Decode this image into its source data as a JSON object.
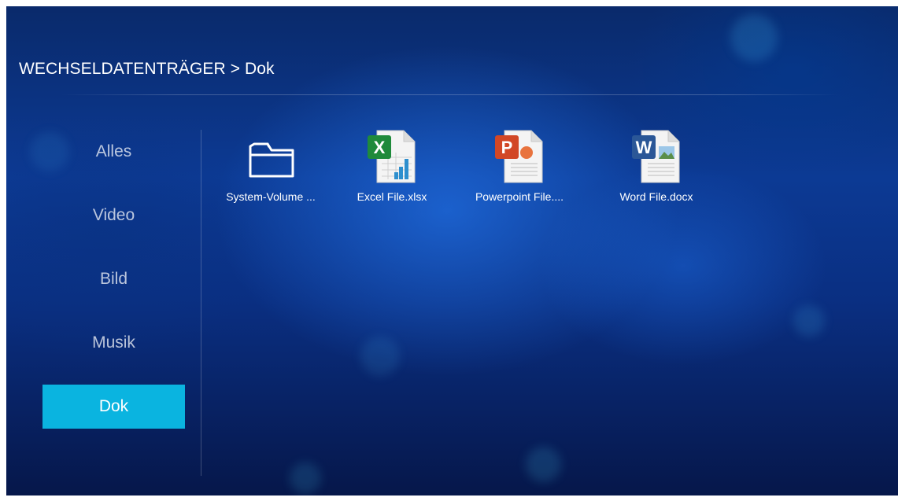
{
  "header": {
    "breadcrumb": "WECHSELDATENTRÄGER > Dok"
  },
  "sidebar": {
    "items": [
      {
        "label": "Alles",
        "active": false
      },
      {
        "label": "Video",
        "active": false
      },
      {
        "label": "Bild",
        "active": false
      },
      {
        "label": "Musik",
        "active": false
      },
      {
        "label": "Dok",
        "active": true
      }
    ]
  },
  "files": [
    {
      "name": "System-Volume ...",
      "icon": "folder-icon"
    },
    {
      "name": "Excel File.xlsx",
      "icon": "excel-file-icon"
    },
    {
      "name": "Powerpoint File....",
      "icon": "powerpoint-file-icon"
    },
    {
      "name": "Word File.docx",
      "icon": "word-file-icon"
    }
  ],
  "colors": {
    "active_item": "#0ab4e0",
    "background": "#0c3a94",
    "excel": "#1f8a3b",
    "powerpoint": "#d24726",
    "word": "#2b5797"
  }
}
